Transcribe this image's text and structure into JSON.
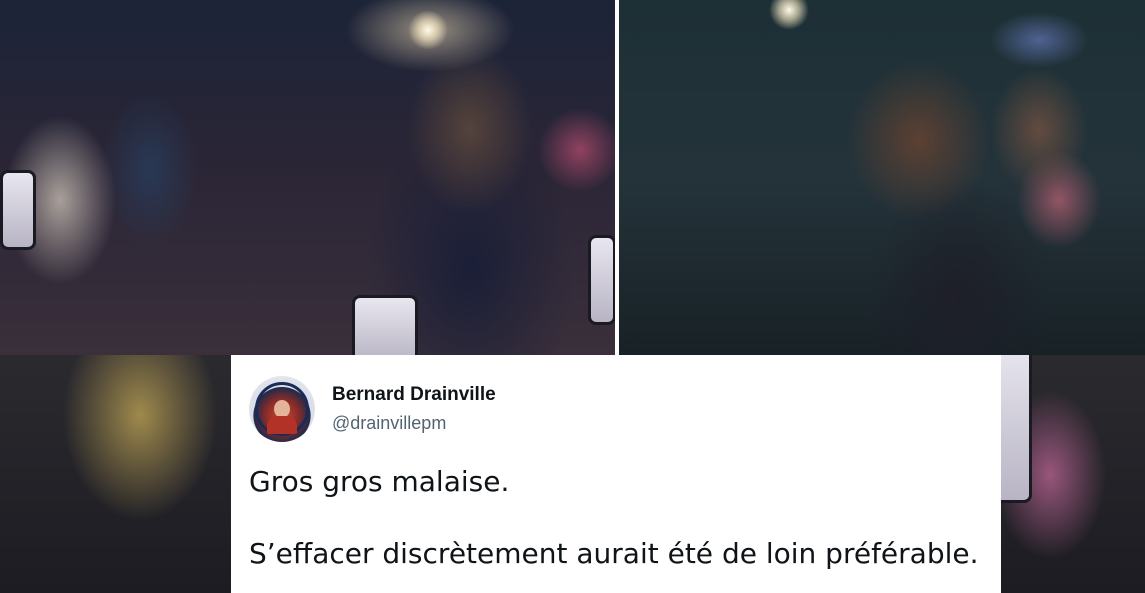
{
  "tweet": {
    "display_name": "Bernard Drainville",
    "handle": "@drainvillepm",
    "paragraphs": [
      "Gros gros malaise.",
      "S’effacer discrètement aurait été de loin préférable."
    ]
  },
  "colors": {
    "name_text": "#0f1419",
    "handle_text": "#536471",
    "card_background": "#ffffff"
  },
  "icons": {
    "avatar": "profile-photo"
  }
}
